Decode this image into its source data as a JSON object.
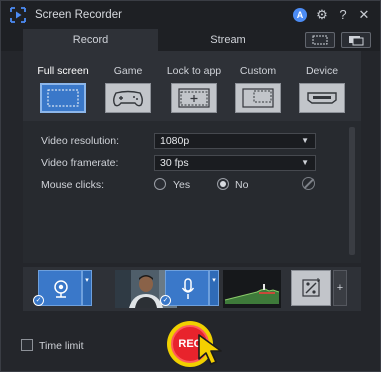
{
  "app": {
    "title": "Screen Recorder",
    "logo_icon": "screen-recorder-logo-icon"
  },
  "titlebar": {
    "user_glyph": "A",
    "gear_glyph": "⚙",
    "help_glyph": "?",
    "close_glyph": "✕"
  },
  "tabs": [
    {
      "label": "Record",
      "active": true
    },
    {
      "label": "Stream",
      "active": false
    }
  ],
  "modes": [
    {
      "label": "Full screen",
      "icon": "full-screen-icon",
      "active": true
    },
    {
      "label": "Game",
      "icon": "gamepad-icon",
      "active": false
    },
    {
      "label": "Lock to app",
      "icon": "lock-to-app-icon",
      "active": false
    },
    {
      "label": "Custom",
      "icon": "custom-area-icon",
      "active": false
    },
    {
      "label": "Device",
      "icon": "hdmi-device-icon",
      "active": false
    }
  ],
  "settings": {
    "resolution": {
      "label": "Video resolution:",
      "value": "1080p"
    },
    "framerate": {
      "label": "Video framerate:",
      "value": "30 fps"
    },
    "mouse_clicks": {
      "label": "Mouse clicks:",
      "yes_label": "Yes",
      "no_label": "No",
      "selected": "No"
    }
  },
  "devices": {
    "webcam_icon": "webcam-icon",
    "mic_icon": "microphone-icon",
    "effects_icon": "effects-icon",
    "add_glyph": "+",
    "check_glyph": "✓",
    "dropdown_glyph": "▾"
  },
  "bottom": {
    "time_limit_label": "Time limit",
    "rec_label": "REC"
  },
  "colors": {
    "accent": "#3a78c9",
    "rec": "#e8232c",
    "highlight": "#f0d000"
  }
}
